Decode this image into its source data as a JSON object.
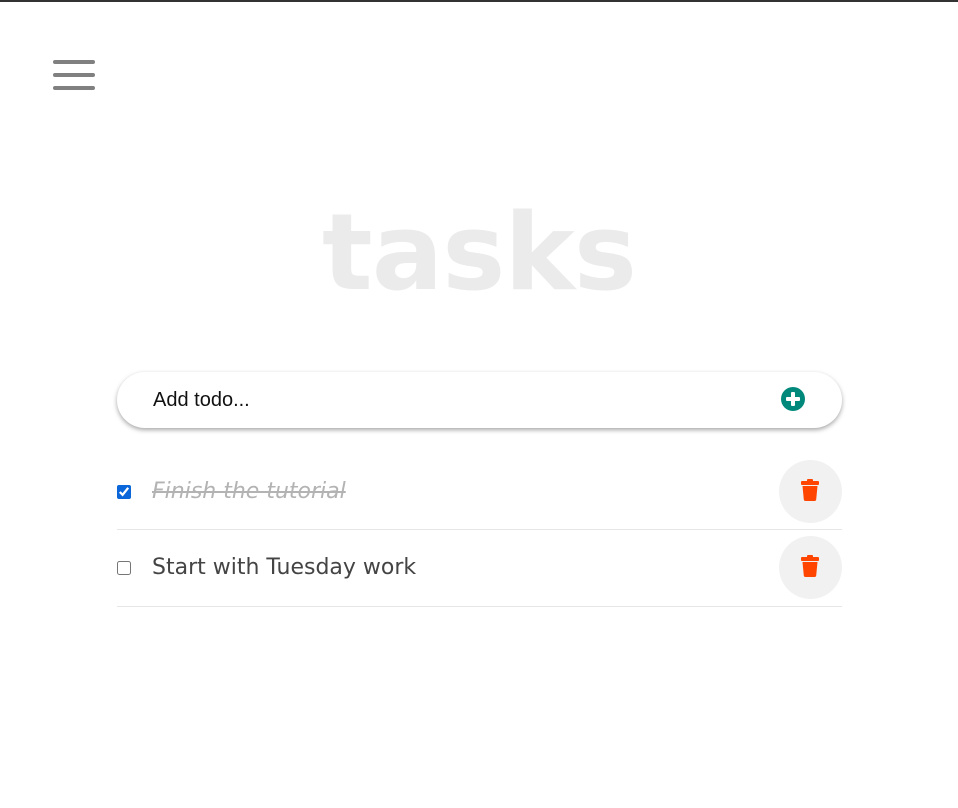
{
  "app": {
    "title": "tasks"
  },
  "add_todo": {
    "placeholder": "Add todo..."
  },
  "todos": [
    {
      "text": "Finish the tutorial",
      "completed": true
    },
    {
      "text": "Start with Tuesday work",
      "completed": false
    }
  ],
  "icons": {
    "menu": "hamburger-menu-icon",
    "add": "plus-circle-icon",
    "delete": "trash-icon"
  },
  "colors": {
    "accent": "#00897b",
    "delete": "#ff4500",
    "title": "#ebebeb",
    "checkbox": "#0a66d9"
  }
}
